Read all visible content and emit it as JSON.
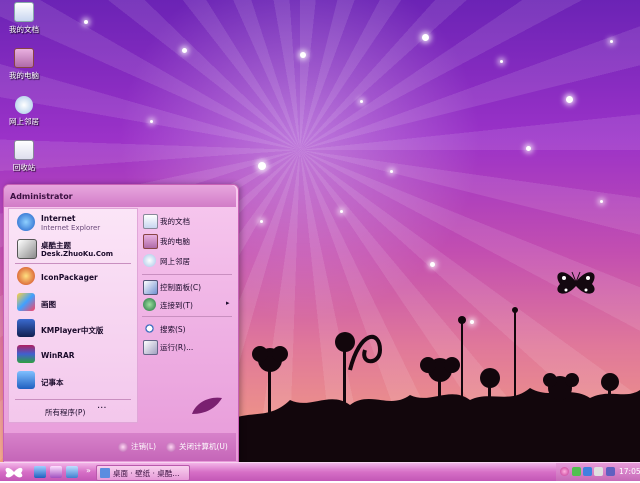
{
  "desktop": {
    "icons": [
      {
        "label": "我的文档",
        "name": "desktop-icon-my-documents"
      },
      {
        "label": "我的电脑",
        "name": "desktop-icon-my-computer"
      },
      {
        "label": "网上邻居",
        "name": "desktop-icon-network"
      },
      {
        "label": "回收站",
        "name": "desktop-icon-recycle-bin"
      }
    ]
  },
  "start_menu": {
    "user": "Administrator",
    "pinned": [
      {
        "title": "Internet",
        "subtitle": "Internet Explorer",
        "icon": "ie-icon"
      },
      {
        "title": "桌酷主题",
        "subtitle": "Desk.ZhuoKu.Com",
        "icon": "zhuoku-icon"
      }
    ],
    "recent": [
      {
        "title": "IconPackager",
        "icon": "iconpackager-icon"
      },
      {
        "title": "画图",
        "icon": "paint-icon"
      },
      {
        "title": "KMPlayer中文版",
        "icon": "kmplayer-icon"
      },
      {
        "title": "WinRAR",
        "icon": "winrar-icon"
      },
      {
        "title": "记事本",
        "icon": "notepad-icon"
      }
    ],
    "all_programs": "所有程序(P)",
    "right": [
      {
        "label": "我的文档",
        "icon": "my-documents-icon"
      },
      {
        "label": "我的电脑",
        "icon": "my-computer-icon"
      },
      {
        "label": "网上邻居",
        "icon": "network-icon"
      },
      {
        "label": "控制面板(C)",
        "icon": "control-panel-icon"
      },
      {
        "label": "连接到(T)",
        "icon": "connect-icon"
      },
      {
        "label": "搜索(S)",
        "icon": "search-icon"
      },
      {
        "label": "运行(R)...",
        "icon": "run-icon"
      }
    ],
    "logoff": "注销(L)",
    "shutdown": "关闭计算机(U)"
  },
  "taskbar": {
    "task_label": "桌面 · 壁纸 · 桌酷...",
    "clock": "17:05"
  },
  "colors": {
    "accent": "#c357b6",
    "menu_bg": "#f3c7ec"
  }
}
